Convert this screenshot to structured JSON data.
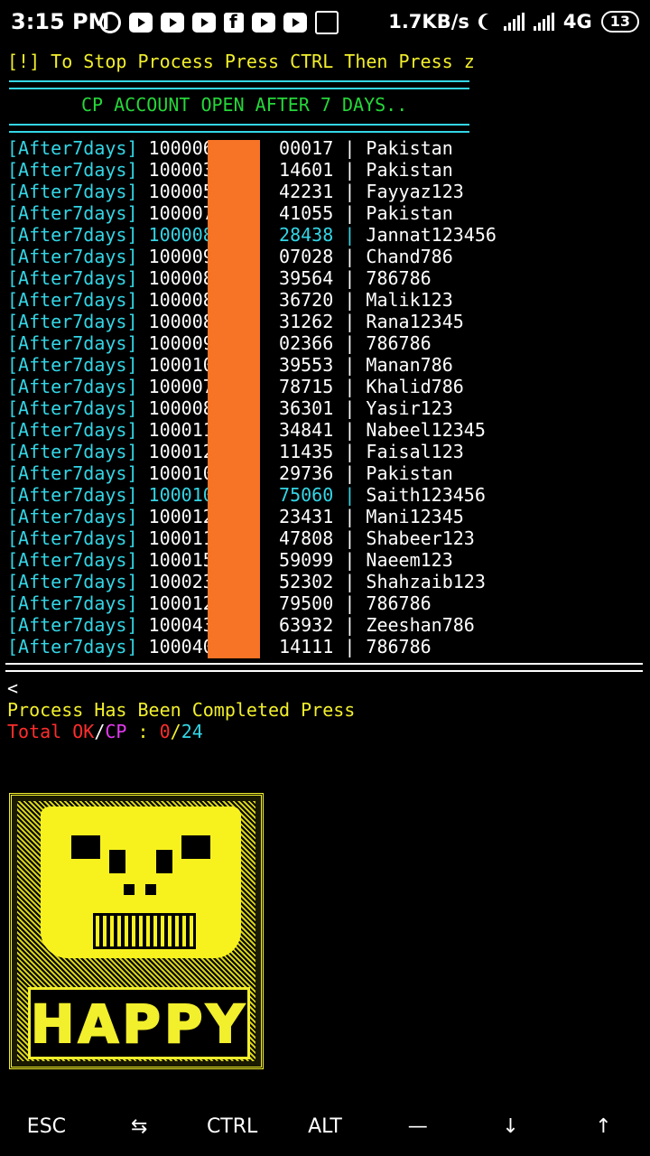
{
  "status_bar": {
    "time": "3:15 PM",
    "speed": "1.7KB/s",
    "network": "4G",
    "battery": "13"
  },
  "terminal": {
    "stop_hint": "[!] To Stop Process Press CTRL Then Press z",
    "banner": "CP ACCOUNT OPEN AFTER 7 DAYS..",
    "rows": [
      {
        "tag": "[After7days]",
        "id": "100006",
        "id_tail": "00017",
        "pass": "Pakistan",
        "hl": false
      },
      {
        "tag": "[After7days]",
        "id": "100003",
        "id_tail": "14601",
        "pass": "Pakistan",
        "hl": false
      },
      {
        "tag": "[After7days]",
        "id": "100005",
        "id_tail": "42231",
        "pass": "Fayyaz123",
        "hl": false
      },
      {
        "tag": "[After7days]",
        "id": "100007",
        "id_tail": "41055",
        "pass": "Pakistan",
        "hl": false
      },
      {
        "tag": "[After7days]",
        "id": "100008",
        "id_tail": "28438",
        "pass": "Jannat123456",
        "hl": true
      },
      {
        "tag": "[After7days]",
        "id": "100009",
        "id_tail": "07028",
        "pass": "Chand786",
        "hl": false
      },
      {
        "tag": "[After7days]",
        "id": "100008",
        "id_tail": "39564",
        "pass": "786786",
        "hl": false
      },
      {
        "tag": "[After7days]",
        "id": "100008",
        "id_tail": "36720",
        "pass": "Malik123",
        "hl": false
      },
      {
        "tag": "[After7days]",
        "id": "100008",
        "id_tail": "31262",
        "pass": "Rana12345",
        "hl": false
      },
      {
        "tag": "[After7days]",
        "id": "100009",
        "id_tail": "02366",
        "pass": "786786",
        "hl": false
      },
      {
        "tag": "[After7days]",
        "id": "100010",
        "id_tail": "39553",
        "pass": "Manan786",
        "hl": false
      },
      {
        "tag": "[After7days]",
        "id": "100007",
        "id_tail": "78715",
        "pass": "Khalid786",
        "hl": false
      },
      {
        "tag": "[After7days]",
        "id": "100008",
        "id_tail": "36301",
        "pass": "Yasir123",
        "hl": false
      },
      {
        "tag": "[After7days]",
        "id": "100011",
        "id_tail": "34841",
        "pass": "Nabeel12345",
        "hl": false
      },
      {
        "tag": "[After7days]",
        "id": "100012",
        "id_tail": "11435",
        "pass": "Faisal123",
        "hl": false
      },
      {
        "tag": "[After7days]",
        "id": "100010",
        "id_tail": "29736",
        "pass": "Pakistan",
        "hl": false
      },
      {
        "tag": "[After7days]",
        "id": "100010",
        "id_tail": "75060",
        "pass": "Saith123456",
        "hl": true
      },
      {
        "tag": "[After7days]",
        "id": "100012",
        "id_tail": "23431",
        "pass": "Mani12345",
        "hl": false
      },
      {
        "tag": "[After7days]",
        "id": "100011",
        "id_tail": "47808",
        "pass": "Shabeer123",
        "hl": false
      },
      {
        "tag": "[After7days]",
        "id": "100015",
        "id_tail": "59099",
        "pass": "Naeem123",
        "hl": false
      },
      {
        "tag": "[After7days]",
        "id": "100023",
        "id_tail": "52302",
        "pass": "Shahzaib123",
        "hl": false
      },
      {
        "tag": "[After7days]",
        "id": "100012",
        "id_tail": "79500",
        "pass": "786786",
        "hl": false
      },
      {
        "tag": "[After7days]",
        "id": "100043",
        "id_tail": "63932",
        "pass": "Zeeshan786",
        "hl": false
      },
      {
        "tag": "[After7days]",
        "id": "100040",
        "id_tail": "14111",
        "pass": "786786",
        "hl": false
      }
    ],
    "completed": "Process Has Been Completed Press",
    "total_label": "Total OK/CP",
    "total_ok_label": "OK",
    "total_cp_label": "CP",
    "total_ok": "0",
    "total_cp": "24"
  },
  "art": {
    "word": "HAPPY"
  },
  "extra_keys": [
    "ESC",
    "⇆",
    "CTRL",
    "ALT",
    "—",
    "↓",
    "↑"
  ]
}
